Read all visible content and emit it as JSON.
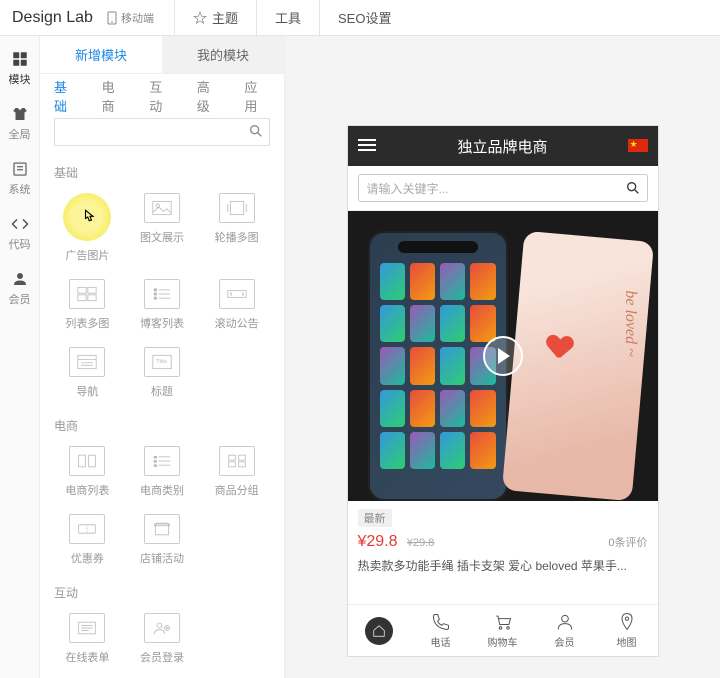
{
  "top": {
    "logo": "Design Lab",
    "device": "移动端",
    "tabs": [
      "主题",
      "工具",
      "SEO设置"
    ]
  },
  "rail": [
    {
      "label": "模块"
    },
    {
      "label": "全局"
    },
    {
      "label": "系统"
    },
    {
      "label": "代码"
    },
    {
      "label": "会员"
    }
  ],
  "panel_tabs": {
    "new": "新增模块",
    "mine": "我的模块"
  },
  "cats": [
    "基础",
    "电商",
    "互动",
    "高级",
    "应用"
  ],
  "search_placeholder": "",
  "groups": {
    "basic": {
      "title": "基础",
      "items": [
        "广告图片",
        "图文展示",
        "轮播多图",
        "列表多图",
        "博客列表",
        "滚动公告",
        "导航",
        "标题"
      ]
    },
    "ecom": {
      "title": "电商",
      "items": [
        "电商列表",
        "电商类别",
        "商品分组",
        "优惠券",
        "店铺活动"
      ]
    },
    "inter": {
      "title": "互动",
      "items": [
        "在线表单",
        "会员登录"
      ]
    }
  },
  "phone": {
    "title": "独立品牌电商",
    "search_placeholder": "请输入关键字...",
    "badge": "最新",
    "price": "¥29.8",
    "price_old": "¥29.8",
    "reviews": "0条评价",
    "desc": "热卖款多功能手绳 插卡支架 爱心 beloved 苹果手...",
    "nav": [
      "电话",
      "购物车",
      "会员",
      "地图"
    ]
  }
}
